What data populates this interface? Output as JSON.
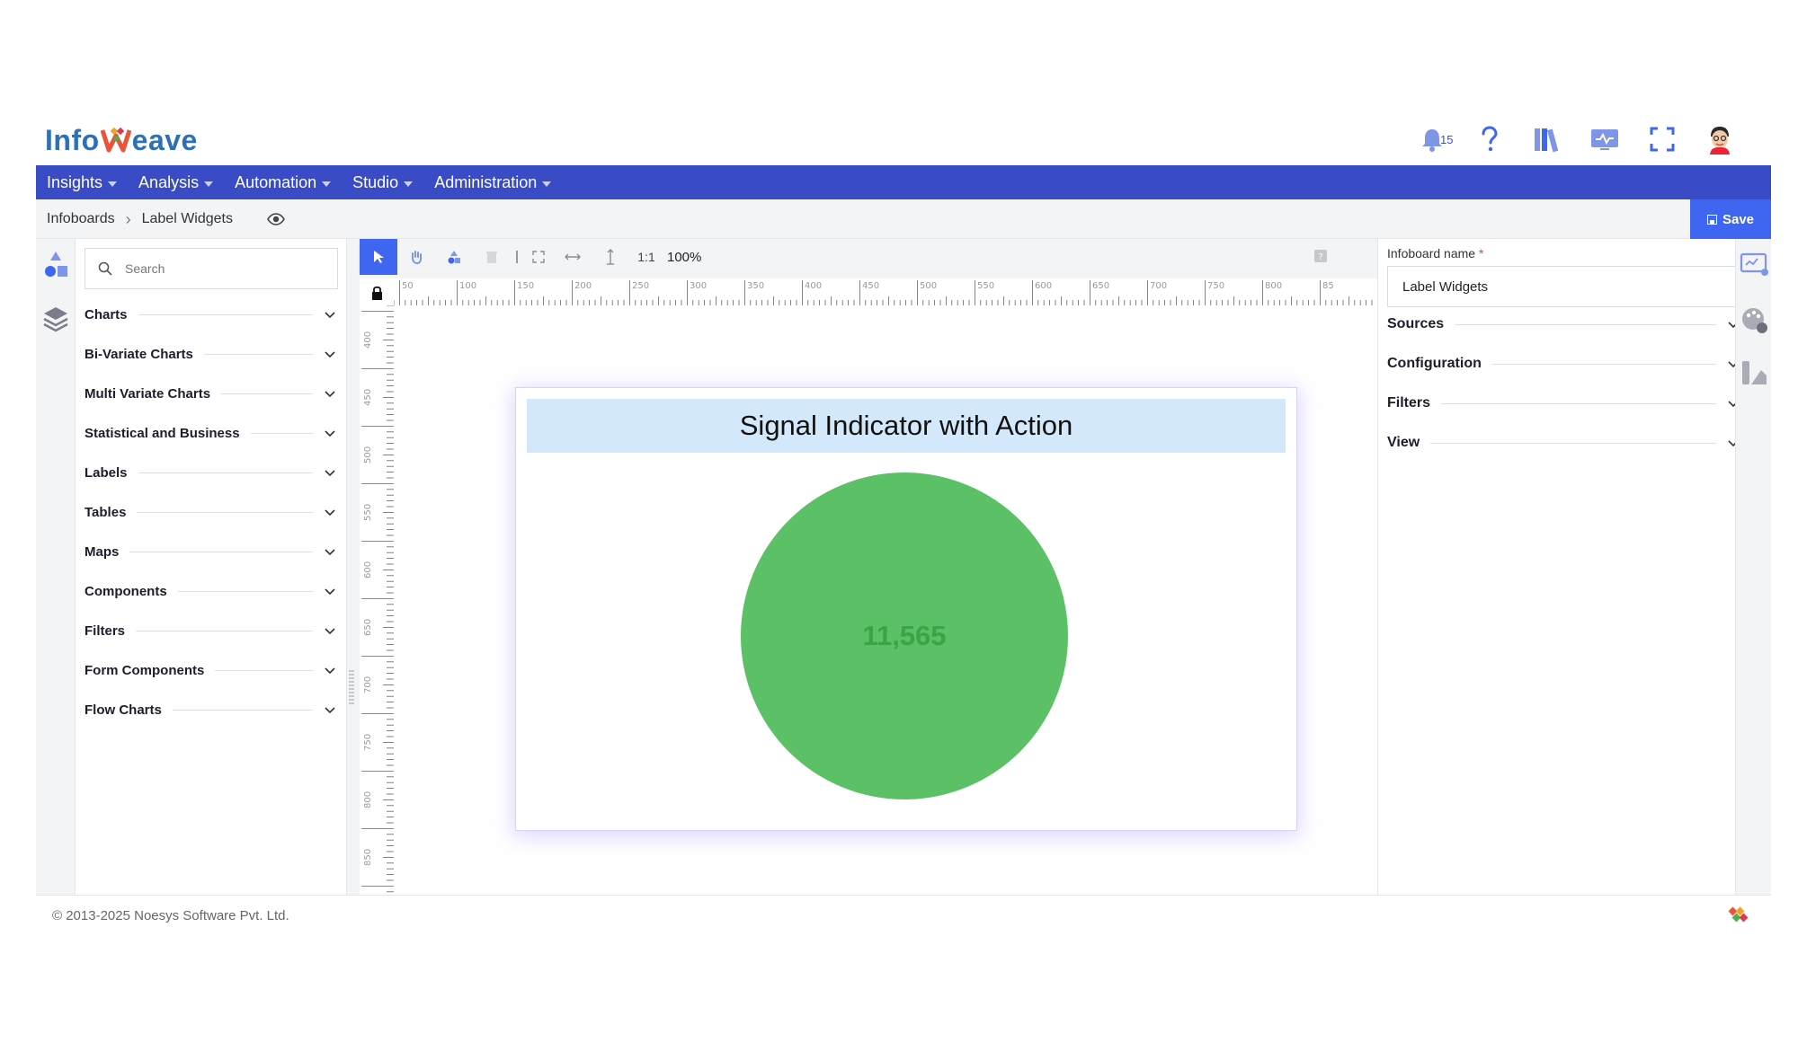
{
  "brand": {
    "logo_prefix": "Info",
    "logo_suffix": "eave",
    "colors": {
      "primary_nav": "#3a4bc6",
      "accent": "#3f66f0",
      "signal_green": "#5bc066",
      "title_bg": "#d4e8fb"
    }
  },
  "header": {
    "notifications_count": "15",
    "icons": [
      "bell-icon",
      "help-icon",
      "library-icon",
      "monitor-icon",
      "fullscreen-icon",
      "avatar"
    ]
  },
  "nav": {
    "items": [
      {
        "label": "Insights"
      },
      {
        "label": "Analysis"
      },
      {
        "label": "Automation"
      },
      {
        "label": "Studio"
      },
      {
        "label": "Administration"
      }
    ]
  },
  "breadcrumb": {
    "root": "Infoboards",
    "current": "Label Widgets"
  },
  "toolbar": {
    "save_label": "Save",
    "ratio_label": "1:1",
    "zoom": "100%"
  },
  "left_panel": {
    "search_placeholder": "Search",
    "categories": [
      {
        "label": "Charts"
      },
      {
        "label": "Bi-Variate Charts"
      },
      {
        "label": "Multi Variate Charts"
      },
      {
        "label": "Statistical and Business"
      },
      {
        "label": "Labels"
      },
      {
        "label": "Tables"
      },
      {
        "label": "Maps"
      },
      {
        "label": "Components"
      },
      {
        "label": "Filters"
      },
      {
        "label": "Form Components"
      },
      {
        "label": "Flow Charts"
      }
    ]
  },
  "rulers": {
    "h_labels": [
      "50",
      "100",
      "150",
      "200",
      "250",
      "300",
      "350",
      "400",
      "450",
      "500",
      "550",
      "600",
      "650",
      "700",
      "750",
      "800",
      "85"
    ],
    "v_labels": [
      "400",
      "450",
      "500",
      "550",
      "600",
      "650",
      "700",
      "750",
      "800",
      "850"
    ]
  },
  "widget": {
    "title": "Signal Indicator with Action",
    "value": "11,565"
  },
  "right_panel": {
    "name_label": "Infoboard name",
    "required_mark": "*",
    "name_value": "Label Widgets",
    "sections": [
      {
        "label": "Sources"
      },
      {
        "label": "Configuration"
      },
      {
        "label": "Filters"
      },
      {
        "label": "View"
      }
    ]
  },
  "footer": {
    "copyright": "© 2013-2025 Noesys Software Pvt. Ltd."
  }
}
